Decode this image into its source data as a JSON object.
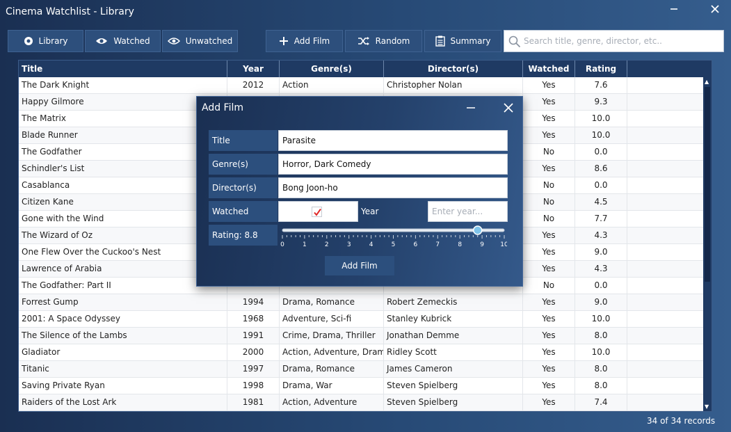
{
  "window": {
    "title": "Cinema Watchlist - Library"
  },
  "nav": {
    "library": "Library",
    "watched": "Watched",
    "unwatched": "Unwatched",
    "add_film": "Add Film",
    "random": "Random",
    "summary": "Summary"
  },
  "search": {
    "placeholder": "Search title, genre, director, etc.."
  },
  "table": {
    "columns": [
      "Title",
      "Year",
      "Genre(s)",
      "Director(s)",
      "Watched",
      "Rating"
    ],
    "rows": [
      {
        "title": "The Dark Knight",
        "year": "2012",
        "genre": "Action",
        "director": "Christopher Nolan",
        "watched": "Yes",
        "rating": "7.6"
      },
      {
        "title": "Happy Gilmore",
        "year": "",
        "genre": "",
        "director": "",
        "watched": "Yes",
        "rating": "9.3"
      },
      {
        "title": "The Matrix",
        "year": "",
        "genre": "",
        "director": "",
        "watched": "Yes",
        "rating": "10.0"
      },
      {
        "title": "Blade Runner",
        "year": "",
        "genre": "",
        "director": "",
        "watched": "Yes",
        "rating": "10.0"
      },
      {
        "title": "The Godfather",
        "year": "",
        "genre": "",
        "director": "",
        "watched": "No",
        "rating": "0.0"
      },
      {
        "title": "Schindler's List",
        "year": "",
        "genre": "",
        "director": "",
        "watched": "Yes",
        "rating": "8.6"
      },
      {
        "title": "Casablanca",
        "year": "",
        "genre": "",
        "director": "",
        "watched": "No",
        "rating": "0.0"
      },
      {
        "title": "Citizen Kane",
        "year": "",
        "genre": "",
        "director": "",
        "watched": "No",
        "rating": "4.5"
      },
      {
        "title": "Gone with the Wind",
        "year": "",
        "genre": "",
        "director": "",
        "watched": "No",
        "rating": "7.7"
      },
      {
        "title": "The Wizard of Oz",
        "year": "",
        "genre": "",
        "director": "",
        "watched": "Yes",
        "rating": "4.3"
      },
      {
        "title": "One Flew Over the Cuckoo's Nest",
        "year": "",
        "genre": "",
        "director": "",
        "watched": "Yes",
        "rating": "9.0"
      },
      {
        "title": "Lawrence of Arabia",
        "year": "",
        "genre": "",
        "director": "",
        "watched": "Yes",
        "rating": "4.3"
      },
      {
        "title": "The Godfather: Part II",
        "year": "",
        "genre": "",
        "director": "",
        "watched": "No",
        "rating": "0.0"
      },
      {
        "title": "Forrest Gump",
        "year": "1994",
        "genre": "Drama, Romance",
        "director": "Robert Zemeckis",
        "watched": "Yes",
        "rating": "9.0"
      },
      {
        "title": "2001: A Space Odyssey",
        "year": "1968",
        "genre": "Adventure, Sci-fi",
        "director": "Stanley Kubrick",
        "watched": "Yes",
        "rating": "10.0"
      },
      {
        "title": "The Silence of the Lambs",
        "year": "1991",
        "genre": "Crime, Drama, Thriller",
        "director": "Jonathan Demme",
        "watched": "Yes",
        "rating": "8.0"
      },
      {
        "title": "Gladiator",
        "year": "2000",
        "genre": "Action, Adventure, Drama",
        "director": "Ridley Scott",
        "watched": "Yes",
        "rating": "10.0"
      },
      {
        "title": "Titanic",
        "year": "1997",
        "genre": "Drama, Romance",
        "director": "James Cameron",
        "watched": "Yes",
        "rating": "8.0"
      },
      {
        "title": "Saving Private Ryan",
        "year": "1998",
        "genre": "Drama, War",
        "director": "Steven Spielberg",
        "watched": "Yes",
        "rating": "8.0"
      },
      {
        "title": "Raiders of the Lost Ark",
        "year": "1981",
        "genre": "Action, Adventure",
        "director": "Steven Spielberg",
        "watched": "Yes",
        "rating": "7.4"
      }
    ]
  },
  "status": {
    "records": "34 of 34 records"
  },
  "dialog": {
    "title": "Add Film",
    "title_label": "Title",
    "title_value": "Parasite",
    "genre_label": "Genre(s)",
    "genre_value": "Horror, Dark Comedy",
    "director_label": "Director(s)",
    "director_value": "Bong Joon-ho",
    "watched_label": "Watched",
    "watched_checked": true,
    "year_label": "Year",
    "year_placeholder": "Enter year...",
    "rating_label": "Rating: 8.8",
    "rating_value": 8.8,
    "rating_min": 0,
    "rating_max": 10,
    "rating_ticks": [
      "0",
      "1",
      "2",
      "3",
      "4",
      "5",
      "6",
      "7",
      "8",
      "9",
      "10"
    ],
    "submit_label": "Add Film"
  },
  "colors": {
    "accent": "#2c4f7d",
    "header": "#1f3a63",
    "check": "#e02a2a",
    "slider_thumb": "#7fc4ea"
  }
}
